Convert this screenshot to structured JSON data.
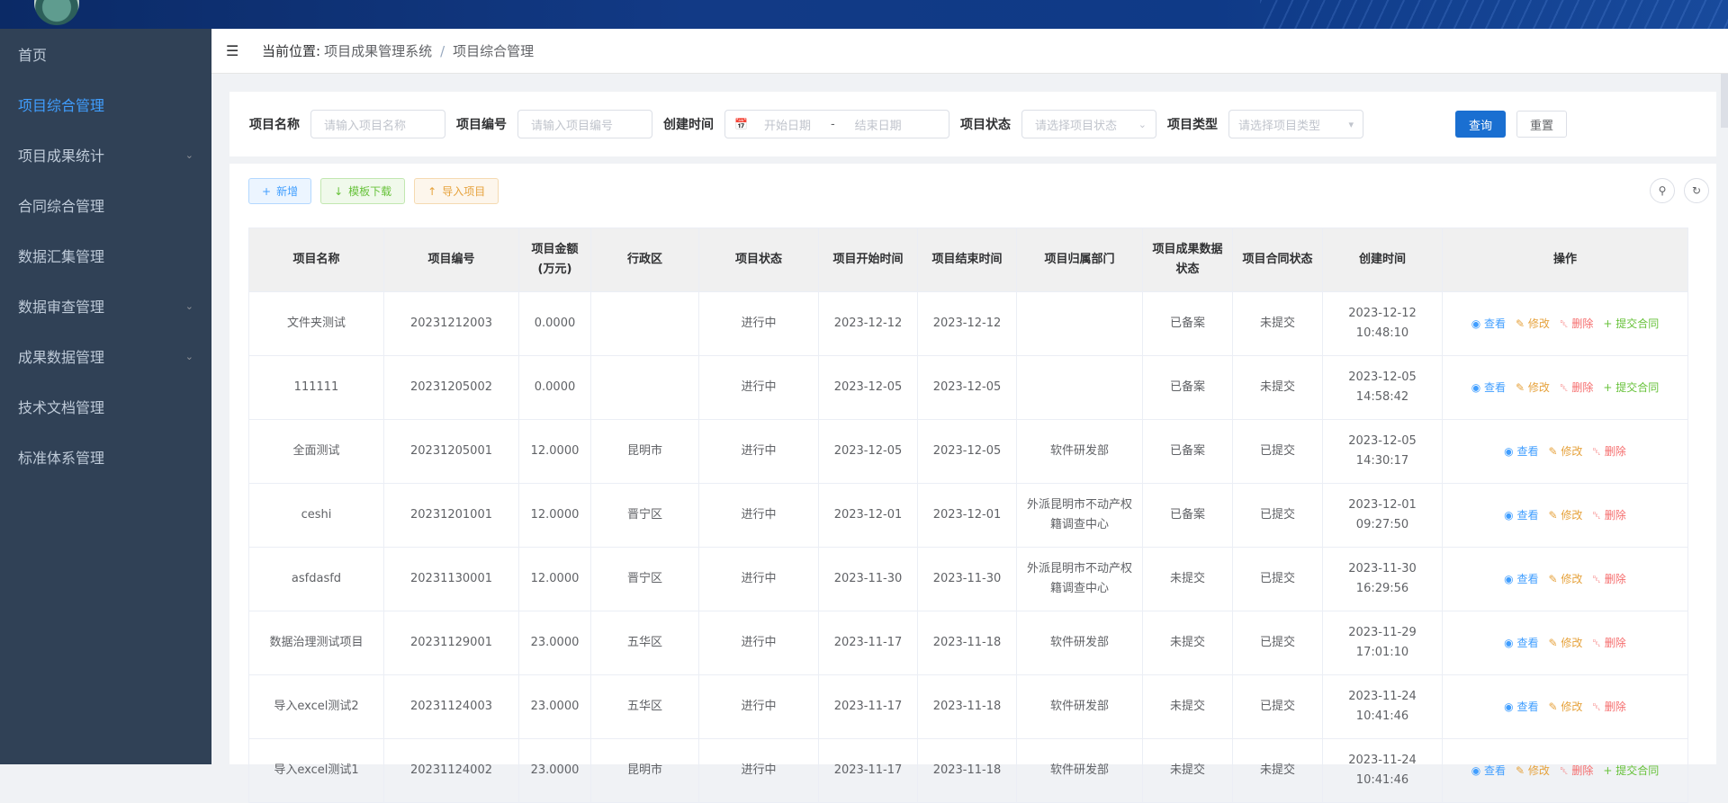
{
  "sidebar": {
    "items": [
      {
        "label": "首页"
      },
      {
        "label": "项目综合管理"
      },
      {
        "label": "项目成果统计"
      },
      {
        "label": "合同综合管理"
      },
      {
        "label": "数据汇集管理"
      },
      {
        "label": "数据审查管理"
      },
      {
        "label": "成果数据管理"
      },
      {
        "label": "技术文档管理"
      },
      {
        "label": "标准体系管理"
      }
    ]
  },
  "navbar": {
    "prefix": "当前位置:",
    "crumbs": [
      "项目成果管理系统",
      "项目综合管理"
    ],
    "separator": "/"
  },
  "search": {
    "name_label": "项目名称",
    "name_placeholder": "请输入项目名称",
    "code_label": "项目编号",
    "code_placeholder": "请输入项目编号",
    "time_label": "创建时间",
    "start_placeholder": "开始日期",
    "range_sep": "-",
    "end_placeholder": "结束日期",
    "status_label": "项目状态",
    "status_placeholder": "请选择项目状态",
    "type_label": "项目类型",
    "type_placeholder": "请选择项目类型",
    "query_label": "查询",
    "reset_label": "重置"
  },
  "toolbar": {
    "add_label": "新增",
    "download_label": "模板下载",
    "import_label": "导入项目"
  },
  "table": {
    "headers": {
      "name": "项目名称",
      "code": "项目编号",
      "amount": "项目金额(万元)",
      "district": "行政区",
      "status": "项目状态",
      "start": "项目开始时间",
      "end": "项目结束时间",
      "dept": "项目归属部门",
      "result_status": "项目成果数据状态",
      "contract_status": "项目合同状态",
      "created": "创建时间",
      "ops": "操作"
    },
    "op_labels": {
      "view": "查看",
      "edit": "修改",
      "delete": "删除",
      "submit_contract": "提交合同"
    },
    "rows": [
      {
        "name": "文件夹测试",
        "code": "20231212003",
        "amount": "0.0000",
        "district": "",
        "status": "进行中",
        "start": "2023-12-12",
        "end": "2023-12-12",
        "dept": "",
        "result_status": "已备案",
        "contract_status": "未提交",
        "created": "2023-12-12 10:48:10"
      },
      {
        "name": "111111",
        "code": "20231205002",
        "amount": "0.0000",
        "district": "",
        "status": "进行中",
        "start": "2023-12-05",
        "end": "2023-12-05",
        "dept": "",
        "result_status": "已备案",
        "contract_status": "未提交",
        "created": "2023-12-05 14:58:42"
      },
      {
        "name": "全面测试",
        "code": "20231205001",
        "amount": "12.0000",
        "district": "昆明市",
        "status": "进行中",
        "start": "2023-12-05",
        "end": "2023-12-05",
        "dept": "软件研发部",
        "result_status": "已备案",
        "contract_status": "已提交",
        "created": "2023-12-05 14:30:17"
      },
      {
        "name": "ceshi",
        "code": "20231201001",
        "amount": "12.0000",
        "district": "晋宁区",
        "status": "进行中",
        "start": "2023-12-01",
        "end": "2023-12-01",
        "dept": "外派昆明市不动产权籍调查中心",
        "result_status": "已备案",
        "contract_status": "已提交",
        "created": "2023-12-01 09:27:50"
      },
      {
        "name": "asfdasfd",
        "code": "20231130001",
        "amount": "12.0000",
        "district": "晋宁区",
        "status": "进行中",
        "start": "2023-11-30",
        "end": "2023-11-30",
        "dept": "外派昆明市不动产权籍调查中心",
        "result_status": "未提交",
        "contract_status": "已提交",
        "created": "2023-11-30 16:29:56"
      },
      {
        "name": "数据治理测试项目",
        "code": "20231129001",
        "amount": "23.0000",
        "district": "五华区",
        "status": "进行中",
        "start": "2023-11-17",
        "end": "2023-11-18",
        "dept": "软件研发部",
        "result_status": "未提交",
        "contract_status": "已提交",
        "created": "2023-11-29 17:01:10"
      },
      {
        "name": "导入excel测试2",
        "code": "20231124003",
        "amount": "23.0000",
        "district": "五华区",
        "status": "进行中",
        "start": "2023-11-17",
        "end": "2023-11-18",
        "dept": "软件研发部",
        "result_status": "未提交",
        "contract_status": "已提交",
        "created": "2023-11-24 10:41:46"
      },
      {
        "name": "导入excel测试1",
        "code": "20231124002",
        "amount": "23.0000",
        "district": "昆明市",
        "status": "进行中",
        "start": "2023-11-17",
        "end": "2023-11-18",
        "dept": "软件研发部",
        "result_status": "未提交",
        "contract_status": "未提交",
        "created": "2023-11-24 10:41:46"
      }
    ]
  },
  "colors": {
    "sidebar_bg": "#304156",
    "active": "#409eff",
    "status_green": "#67c23a",
    "status_red": "#f56c6c",
    "primary_button": "#1a6fd1"
  }
}
